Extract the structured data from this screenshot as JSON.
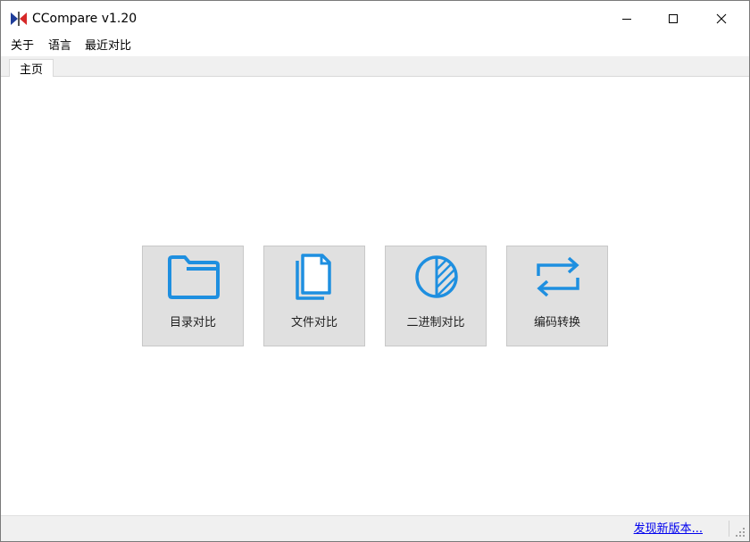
{
  "window": {
    "title": "CCompare  v1.20"
  },
  "menu": {
    "items": [
      "关于",
      "语言",
      "最近对比"
    ]
  },
  "tabs": [
    {
      "label": "主页",
      "active": true
    }
  ],
  "tiles": [
    {
      "label": "目录对比",
      "icon": "folder-icon"
    },
    {
      "label": "文件对比",
      "icon": "files-icon"
    },
    {
      "label": "二进制对比",
      "icon": "binary-compare-icon"
    },
    {
      "label": "编码转换",
      "icon": "swap-arrows-icon"
    }
  ],
  "status": {
    "update_link": "发现新版本..."
  },
  "colors": {
    "accent": "#1e8fe0",
    "tile_bg": "#e0e0e0",
    "link": "#0000ee"
  }
}
